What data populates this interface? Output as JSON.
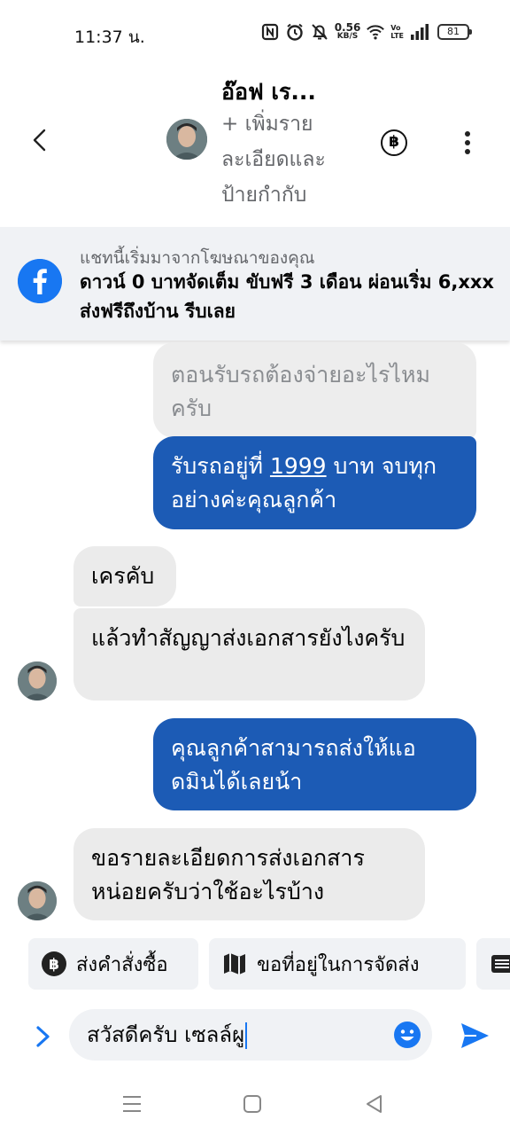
{
  "status_bar": {
    "time": "11:37 น.",
    "net_speed_value": "0.56",
    "net_speed_unit": "KB/S",
    "volte_top": "Vo",
    "volte_bottom": "LTE",
    "battery": "81",
    "icons": [
      "nfc-icon",
      "alarm-icon",
      "mute-icon",
      "wifi-icon",
      "signal-icon"
    ]
  },
  "header": {
    "name": "อ๊อฟ เร...",
    "subtitle": "+ เพิ่มรายละเอียดและป้ายกำกับ",
    "baht_symbol": "฿"
  },
  "ad_banner": {
    "caption": "แชทนี้เริ่มมาจากโฆษณาของคุณ",
    "title": "ดาวน์ 0 บาทจัดเต็ม ขับฟรี 3 เดือน ผ่อนเริ่ม 6,xxx ส่งฟรีถึงบ้าน รีบเลย"
  },
  "messages": [
    {
      "sender": "page",
      "text": "ตอนรับรถต้องจ่ายอะไรไหมครับ"
    },
    {
      "sender": "page",
      "text_parts": [
        "รับรถอยู่ที่ ",
        "1999",
        " บาท  จบทุกอย่างค่ะคุณลูกค้า"
      ]
    },
    {
      "sender": "customer",
      "text": "เครคับ"
    },
    {
      "sender": "customer",
      "text": "แล้วทำสัญญาส่งเอกสารยังไงครับ"
    },
    {
      "sender": "page",
      "text": "คุณลูกค้าสามารถส่งให้แอดมินได้เลยน้า"
    },
    {
      "sender": "customer",
      "text": "ขอรายละเอียดการส่งเอกสารหน่อยครับว่าใช้อะไรบ้าง"
    }
  ],
  "quick_replies": [
    {
      "label": "ส่งคำสั่งซื้อ",
      "icon": "baht-icon"
    },
    {
      "label": "ขอที่อยู่ในการจัดส่ง",
      "icon": "map-icon"
    },
    {
      "label": "",
      "icon": "list-icon"
    }
  ],
  "composer": {
    "value": "สวัสดีครับ เซลล์ผู"
  },
  "colors": {
    "outgoing_bubble": "#1c5bb5",
    "incoming_bubble": "#ebebeb",
    "accent": "#1877f2"
  }
}
